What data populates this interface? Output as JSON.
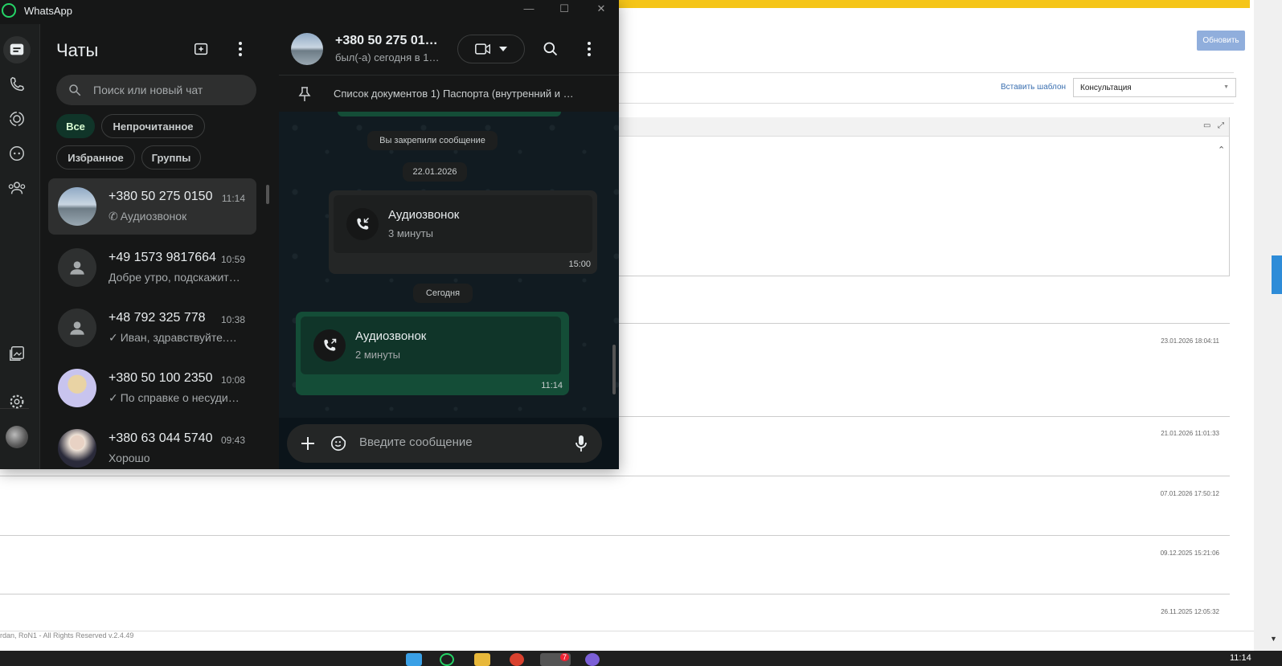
{
  "background_page": {
    "refresh_button": "Обновить",
    "insert_template_link": "Вставить шаблон",
    "template_select_value": "Консультация",
    "row_dates": [
      "23.01.2026 18:04:11",
      "21.01.2026 11:01:33",
      "07.01.2026 17:50:12",
      "09.12.2025 15:21:06",
      "26.11.2025 12:05:32"
    ],
    "footer": "rdan, RoN1 - All Rights Reserved v.2.4.49"
  },
  "taskbar": {
    "time": "11:14",
    "badge": "7"
  },
  "whatsapp": {
    "window_title": "WhatsApp",
    "chatlist": {
      "title": "Чаты",
      "search_placeholder": "Поиск или новый чат",
      "filters": [
        {
          "label": "Все",
          "active": true
        },
        {
          "label": "Непрочитанное",
          "active": false
        },
        {
          "label": "Избранное",
          "active": false
        },
        {
          "label": "Группы",
          "active": false
        }
      ],
      "chats": [
        {
          "name": "+380 50 275 0150",
          "time": "11:14",
          "preview": "Аудиозвонок",
          "preview_icon": "phone-icon",
          "selected": true
        },
        {
          "name": "+49 1573 9817664",
          "time": "10:59",
          "preview": "Добре утро, подскажит…",
          "preview_icon": "",
          "selected": false
        },
        {
          "name": "+48 792 325 778",
          "time": "10:38",
          "preview": "Иван, здравствуйте.…",
          "preview_icon": "check-icon",
          "selected": false
        },
        {
          "name": "+380 50 100 2350",
          "time": "10:08",
          "preview": "По справке о несуди…",
          "preview_icon": "check-icon",
          "selected": false
        },
        {
          "name": "+380 63 044 5740",
          "time": "09:43",
          "preview": "Хорошо",
          "preview_icon": "",
          "selected": false
        }
      ]
    },
    "chat": {
      "contact_name": "+380 50 275 01…",
      "contact_status": "был(-а) сегодня в 1…",
      "pinned_text": "Список документов 1) Паспорта (внутренний и …",
      "system_pinned": "Вы закрепили сообщение",
      "date_1": "22.01.2026",
      "call_in": {
        "title": "Аудиозвонок",
        "duration": "3 минуты",
        "time": "15:00"
      },
      "date_2": "Сегодня",
      "call_out": {
        "title": "Аудиозвонок",
        "duration": "2 минуты",
        "time": "11:14"
      },
      "composer_placeholder": "Введите сообщение"
    },
    "colors": {
      "accent": "#25d366",
      "outgoing_bubble": "#144d37",
      "filter_active": "#103529"
    }
  }
}
